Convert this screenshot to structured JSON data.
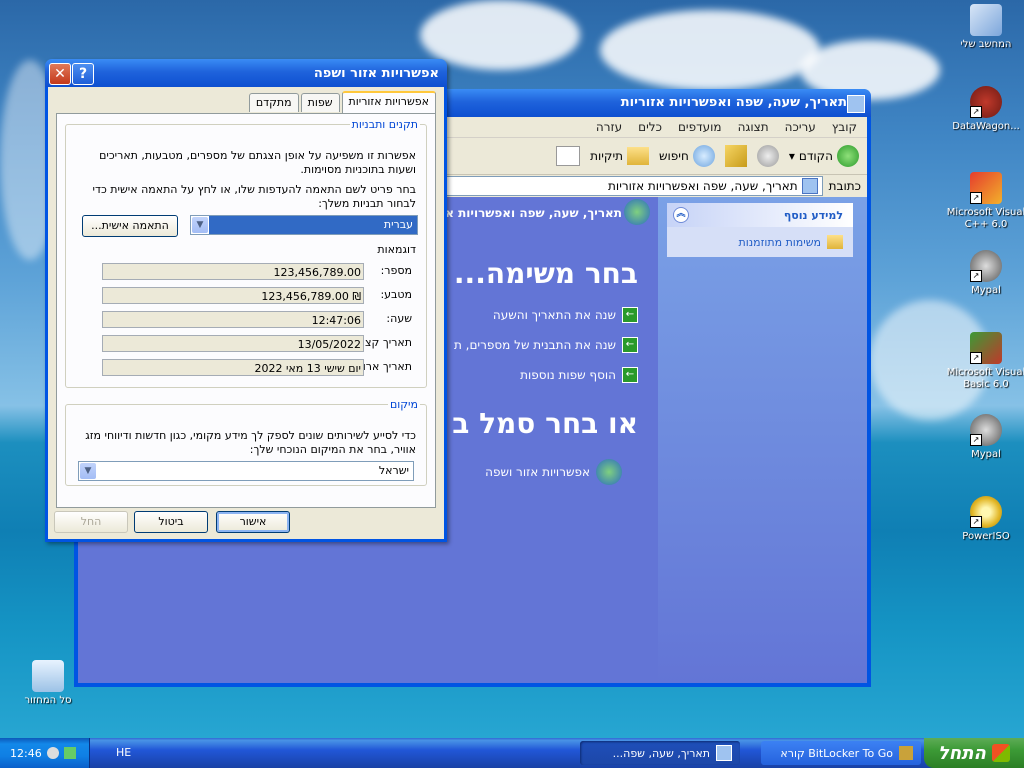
{
  "desktop": {
    "icons": [
      {
        "label": "המחשב שלי",
        "icon": "my-computer-icon"
      },
      {
        "label": "DataWagon...",
        "icon": "datawagon-icon"
      },
      {
        "label": "Microsoft Visual C++ 6.0",
        "icon": "visual-cpp-icon"
      },
      {
        "label": "Mypal",
        "icon": "mypal-icon"
      },
      {
        "label": "Microsoft Visual Basic 6.0",
        "icon": "visual-basic-icon"
      },
      {
        "label": "Mypal",
        "icon": "mypal-icon"
      },
      {
        "label": "PowerISO",
        "icon": "poweriso-icon"
      },
      {
        "label": "סל המחזור",
        "icon": "recycle-bin-icon"
      }
    ]
  },
  "explorer": {
    "title": "תאריך, שעה, שפה ואפשרויות אזוריות",
    "menu": [
      "קובץ",
      "עריכה",
      "תצוגה",
      "מועדפים",
      "כלים",
      "עזרה"
    ],
    "toolbar": {
      "back": "הקודם",
      "search": "חיפוש",
      "folders": "תיקיות"
    },
    "address": {
      "label": "כתובת",
      "value": "תאריך, שעה, שפה ואפשרויות אזוריות"
    },
    "header": "תאריך, שעה, שפה ואפשרויות א",
    "pick_task": "בחר משימה...",
    "tasks": [
      "שנה את התאריך והשעה",
      "שנה את התבנית של מספרים, ת",
      "הוסף שפות נוספות"
    ],
    "pick_icon": "או בחר סמל ב",
    "cp_icon": "אפשרויות אזור ושפה",
    "side": {
      "heading": "למידע נוסף",
      "item": "משימות מתוזמנות"
    }
  },
  "dialog": {
    "title": "אפשרויות אזור ושפה",
    "tabs": [
      "אפשרויות אזוריות",
      "שפות",
      "מתקדם"
    ],
    "standards": {
      "legend": "תקנים ותבניות",
      "desc": "אפשרות זו משפיעה על אופן הצגתם של מספרים, מטבעות, תאריכים ושעות בתוכניות מסוימות.",
      "instruction": "בחר פריט לשם התאמה להעדפות שלו, או לחץ על התאמה אישית כדי לבחור תבניות משלך:",
      "locale": "עברית",
      "customize": "התאמה אישית...",
      "samples_title": "דוגמאות",
      "samples": [
        {
          "label": "מספר:",
          "value": "123,456,789.00"
        },
        {
          "label": "מטבע:",
          "value": "₪ 123,456,789.00"
        },
        {
          "label": "שעה:",
          "value": "12:47:06"
        },
        {
          "label": "תאריך קצר:",
          "value": "13/05/2022"
        },
        {
          "label": "תאריך ארוך:",
          "value": "יום שישי 13 מאי 2022"
        }
      ]
    },
    "location": {
      "legend": "מיקום",
      "desc": "כדי לסייע לשירותים שונים לספק לך מידע מקומי, כגון חדשות ודיווחי מזג אוויר, בחר את המיקום הנוכחי שלך:",
      "value": "ישראל"
    },
    "buttons": {
      "ok": "אישור",
      "cancel": "ביטול",
      "apply": "החל"
    }
  },
  "taskbar": {
    "start": "התחל",
    "tasks": [
      "BitLocker To Go קורא",
      "תאריך, שעה, שפה..."
    ],
    "lang": "HE",
    "time": "12:46"
  },
  "colors": {
    "title_blue": "#0054e3",
    "start_green": "#3c9a36",
    "panel_blue": "#6375d6"
  }
}
